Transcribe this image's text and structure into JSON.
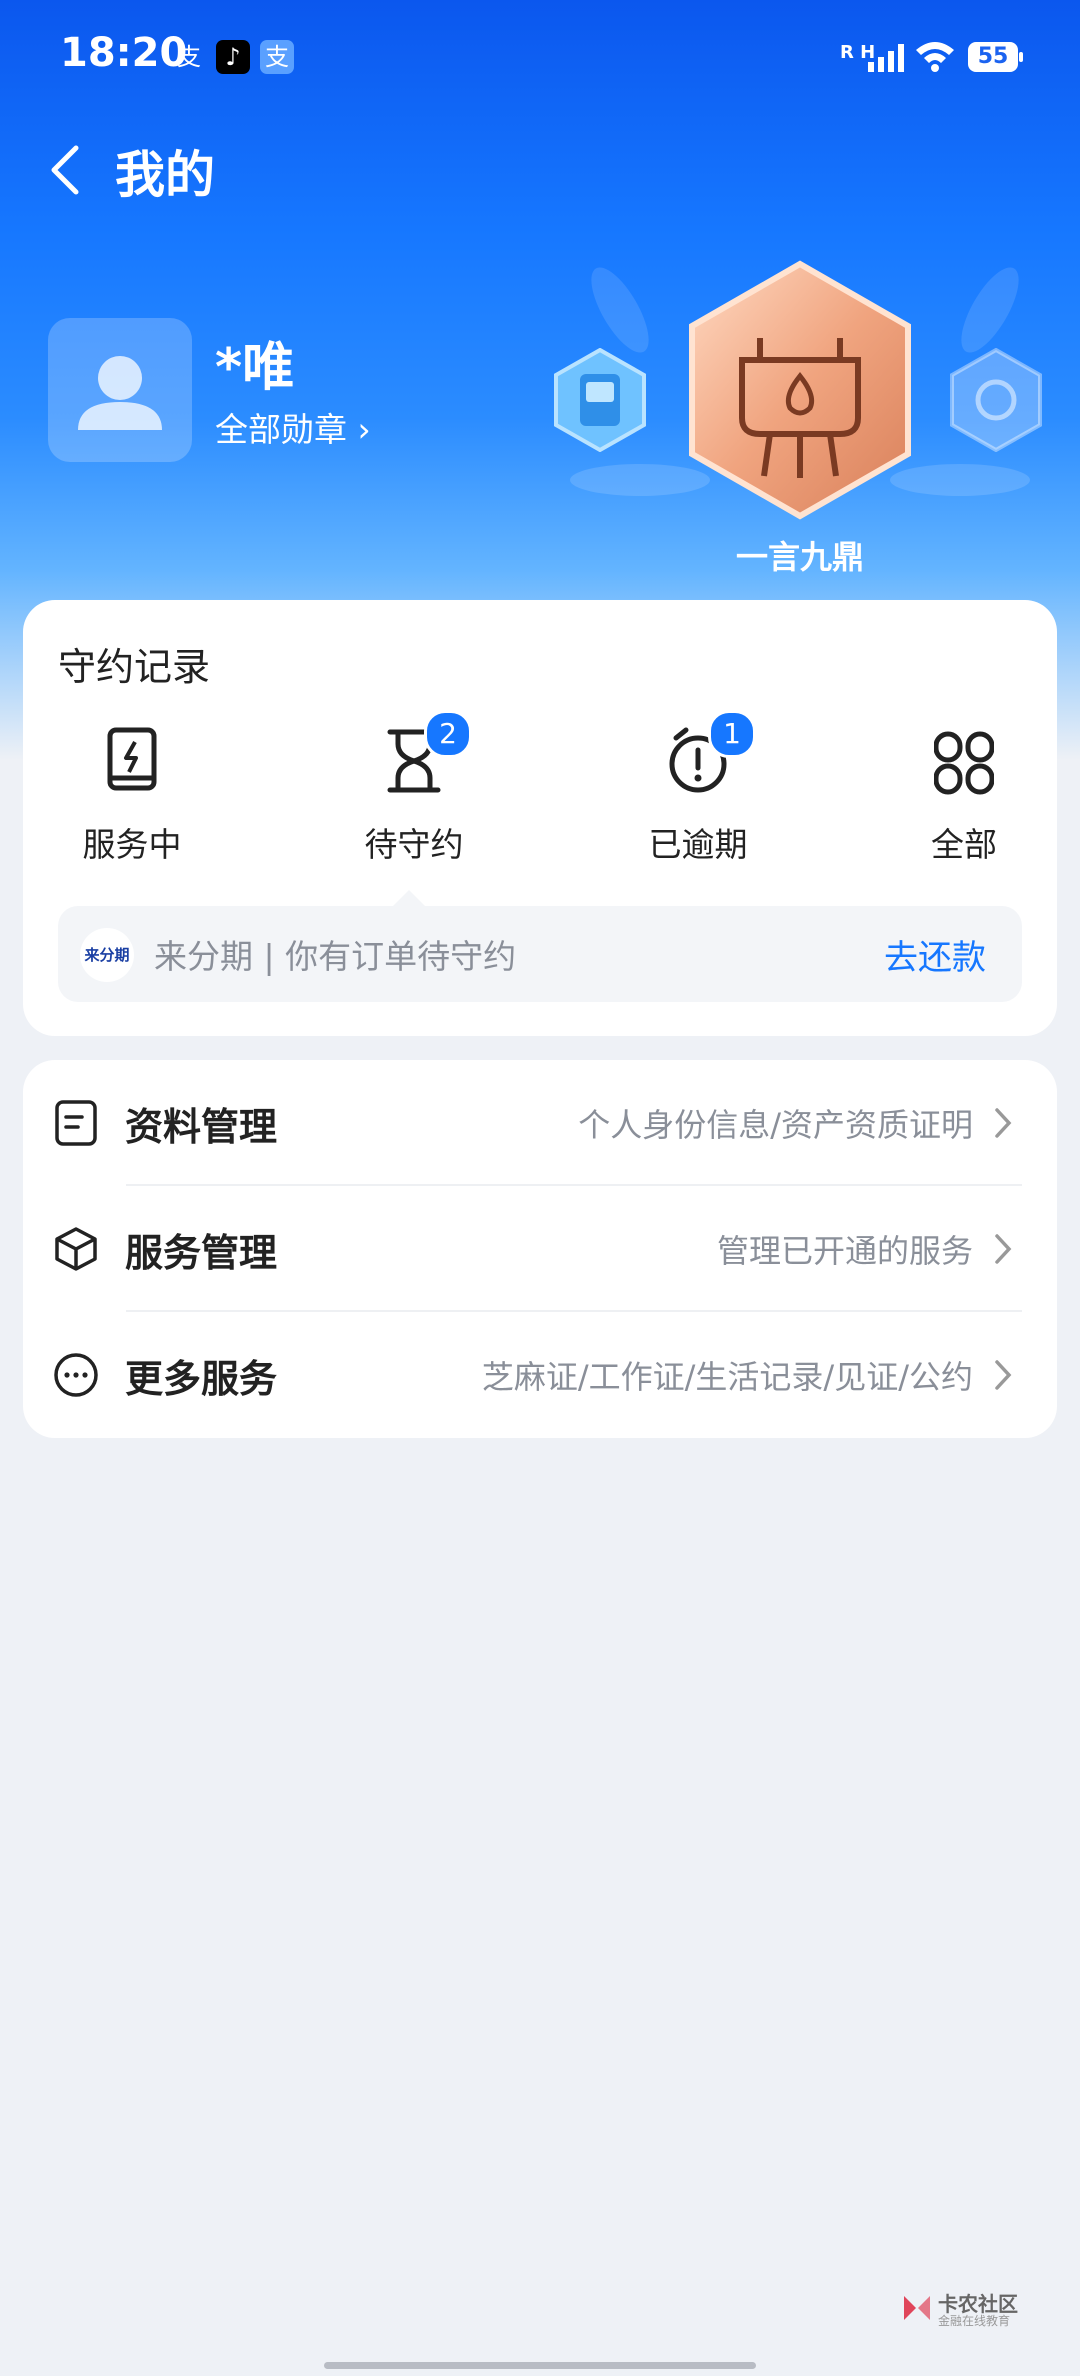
{
  "status_bar": {
    "time": "18:20",
    "battery": "55",
    "network": "R H",
    "app_icons": [
      "支",
      "♪",
      "支"
    ]
  },
  "nav": {
    "title": "我的"
  },
  "profile": {
    "name": "*唯",
    "all_medals": "全部勋章 ›",
    "medal_name": "一言九鼎"
  },
  "records": {
    "title": "守约记录",
    "items": [
      {
        "label": "服务中",
        "badge": ""
      },
      {
        "label": "待守约",
        "badge": "2"
      },
      {
        "label": "已逾期",
        "badge": "1"
      },
      {
        "label": "全部",
        "badge": ""
      }
    ],
    "notice": {
      "logo": "来分期",
      "text": "来分期 | 你有订单待守约",
      "action": "去还款"
    }
  },
  "management": [
    {
      "title": "资料管理",
      "desc": "个人身份信息/资产资质证明"
    },
    {
      "title": "服务管理",
      "desc": "管理已开通的服务"
    },
    {
      "title": "更多服务",
      "desc": "芝麻证/工作证/生活记录/见证/公约"
    }
  ],
  "watermark": {
    "text": "卡农社区",
    "sub": "金融在线教育"
  },
  "colors": {
    "brand_blue": "#1677ff",
    "header_top": "#0b57ee",
    "background": "#eef1f6"
  }
}
